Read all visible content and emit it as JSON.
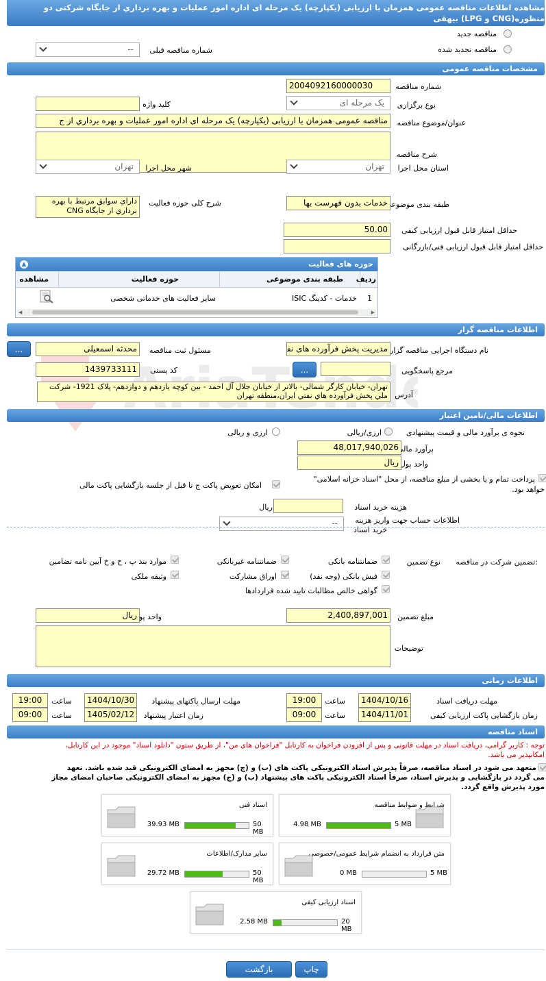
{
  "title_line1": "مشاهده اطلاعات مناقصه عمومی همزمان با ارزیابی (یکپارچه) یک مرحله ای اداره امور عملیات و بهره برداري از جایگاه شرکتی دو",
  "title_line2": "منظوره(CNG و LPG) بیهقی",
  "new_tender": "مناقصه جدید",
  "renewed_tender": "مناقصه تجدید شده",
  "prev_tender_label": "شماره مناقصه قبلی",
  "prev_tender_value": "--",
  "sec_general": "مشخصات مناقصه عمومی",
  "tender_no_label": "شماره مناقصه",
  "tender_no": "2004092160000030",
  "type_label": "نوع برگزاری",
  "type_value": "یک مرحله ای",
  "keyword_label": "کلید واژه",
  "subject_label": "عنوان/موضوع مناقصه",
  "subject_value": "مناقصه عمومی همزمان با ارزیابی (یکپارچه) یک مرحله ای اداره امور عملیات و بهره برداري از ج",
  "desc_label": "شرح مناقصه",
  "province_label": "استان محل اجرا",
  "province_value": "تهران",
  "city_label": "شهر محل اجرا",
  "city_value": "تهران",
  "category_label": "طبقه بندی موضوعی",
  "category_value": "خدمات بدون فهرست بها",
  "activity_desc_label": "شرح کلی حوزه فعالیت",
  "activity_desc_value": "داراي سوابق مرتبط با بهره برداري از جايگاه CNG",
  "min_quality_label": "حداقل امتیاز قابل قبول ارزیابی کیفی",
  "min_quality": "50.00",
  "min_tech_label": "حداقل امتیاز قابل قبول ارزیابی فنی/بازرگانی",
  "activity_panel_title": "حوزه های فعالیت",
  "col_row": "ردیف",
  "col_category": "طبقه بندی موضوعی",
  "col_activity": "حوزه فعالیت",
  "col_view": "مشاهده",
  "row1_no": "1",
  "row1_cat": "خدمات - کدینگ ISIC",
  "row1_act": "سایر فعالیت های خدماتی شخصی",
  "sec_owner": "اطلاعات مناقصه گزار",
  "org_label": "نام دستگاه اجرایی مناقصه گزار",
  "org_value": "مدیریت پخش فرآورده های نفتی",
  "resp_label": "مسئول ثبت مناقصه",
  "resp_value": "محدثه اسمعیلی",
  "ref_label": "مرجع پاسخگویی",
  "postal_label": "کد پستی",
  "postal_value": "1439733111",
  "address_label": "آدرس",
  "address_value": "تهران- خیابان کارگر شمالی- بالاتر از خیابان جلال آل احمد - بین کوچه یازدهم و دوازدهم- پلاک 1921- شرکت ملي پخش فرآورده هاي نفتي ايران،منطقه تهران",
  "btn_dots": "...",
  "sec_finance": "اطلاعات مالی/تامین اعتبار",
  "estimate_method_label": "نحوه ی برآورد مالی و قیمت پیشنهادی",
  "opt_rial": "ارزی/ریالی",
  "opt_rial2": "ارزی و ریالی",
  "estimate_label": "برآورد مالی",
  "estimate_value": "48,017,940,026",
  "currency_label": "واحد پول",
  "currency_value": "ریال",
  "payment_text1": "پرداخت تمام و یا بخشی از مبلغ مناقصه، از محل \"اسناد خزانه اسلامی\"",
  "payment_text2": "خواهد بود.",
  "exchange_text": "امکان تعویض پاکت ج تا قبل از جلسه بازگشایی پاکت مالی",
  "doc_cost_label": "هزینه خرید اسناد",
  "doc_cost_unit": "ریال",
  "account_label1": "اطلاعات حساب جهت واریز هزینه",
  "account_label2": "خرید اسناد",
  "account_value": "--",
  "guarantee_label": "تضمین شرکت در مناقصه:",
  "guarantee_type_label": "نوع تضمین",
  "g1": "ضمانتنامه بانکی",
  "g2": "ضمانتنامه غیربانکی",
  "g3": "موارد بند پ ، ح و خ آیین نامه تضامین",
  "g4": "فیش بانکی (وجه نقد)",
  "g5": "اوراق مشارکت",
  "g6": "وثیقه ملکی",
  "g7": "گواهی خالص مطالبات تایید شده قراردادها",
  "guarantee_amount_label": "مبلغ تضمین",
  "guarantee_amount": "2,400,897,001",
  "g_currency_label": "واحد پول",
  "g_currency": "ریال",
  "notes_label": "توضیحات",
  "sec_time": "اطلاعات زمانی",
  "doc_receive_label": "مهلت دریافت اسناد",
  "doc_receive_date": "1404/10/16",
  "doc_receive_time": "19:00",
  "send_deadline_label": "مهلت ارسال پاکتهای پیشنهاد",
  "send_deadline_date": "1404/10/30",
  "send_deadline_time": "19:00",
  "open_label": "زمان بازگشایی پاکت ارزیابی کیفی",
  "open_date": "1404/11/01",
  "open_time": "09:00",
  "validity_label": "زمان اعتبار پیشنهاد",
  "validity_date": "1405/02/12",
  "validity_time": "09:00",
  "hour_label": "ساعت",
  "sec_docs": "اسناد مناقصه",
  "note1": "توجه : کاربر گرامی، دریافت اسناد در مهلت قانونی و پس از افزودن فراخوان به کارتابل \"فراخوان های من\"، از طریق ستون \"دانلود اسناد\" موجود در این کارتابل،",
  "note2": "امکانپذیر می باشد.",
  "commit1": "متعهد می شود در اسناد مناقصه، صرفاً پذیرش اسناد الکترونیکی پاکت های (ب) و (ج) مجهز به امضای الکترونیکی قید شده باشد. تعهد",
  "commit2": "می گردد در بازگشایی و پذیرش اسناد، صرفاً اسناد الکترونیکی پاکت های پیشنهاد (ب) و (ج) مجهز به امضای الکترونیکی صاحبان امضای مجاز",
  "commit3": "مورد پذیرش واقع گردد.",
  "doc_cards": [
    {
      "title": "شرایط و ضوابط مناقصه",
      "size": "4.98 MB",
      "max": "5 MB",
      "fill": 0.996
    },
    {
      "title": "اسناد فنی",
      "size": "39.93 MB",
      "max": "50 MB",
      "fill": 0.8
    },
    {
      "title": "متن قرارداد به انضمام شرایط عمومی/خصوصی",
      "size": "0 MB",
      "max": "5 MB",
      "fill": 0
    },
    {
      "title": "سایر مدارک/اطلاعات",
      "size": "29.72 MB",
      "max": "50 MB",
      "fill": 0.59
    },
    {
      "title": "اسناد ارزیابی کیفی",
      "size": "2.58 MB",
      "max": "20 MB",
      "fill": 0.13
    }
  ],
  "btn_back": "بازگشت",
  "btn_print": "چاپ",
  "colors": {
    "header": "#3b7fc8",
    "input_bg": "#ffffc4",
    "progress": "#4cbb17",
    "note": "#cc0000"
  }
}
